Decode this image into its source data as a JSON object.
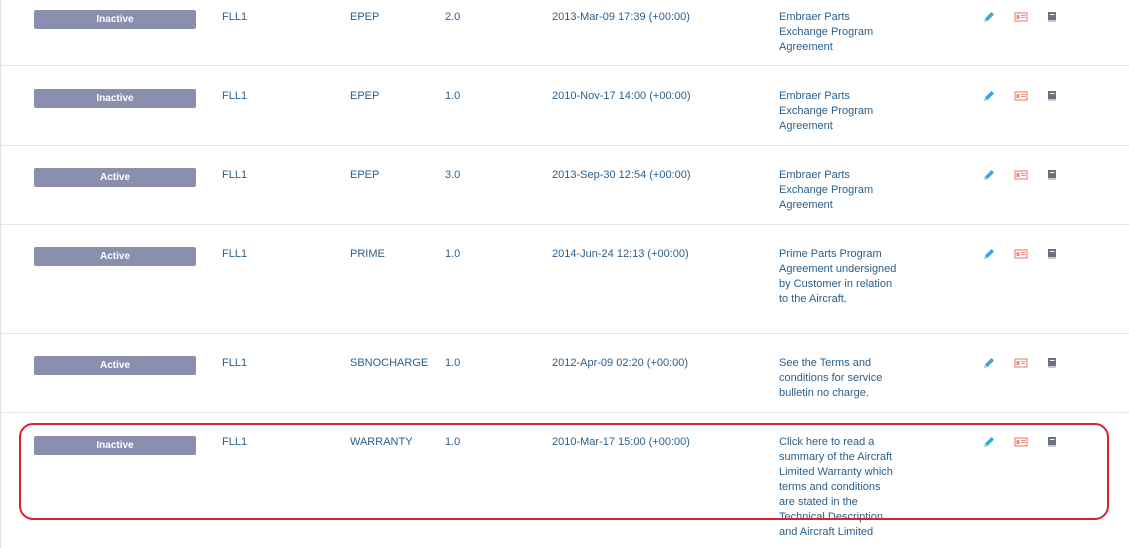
{
  "rows": [
    {
      "status": "Inactive",
      "code": "FLL1",
      "program": "EPEP",
      "version": "2.0",
      "date": "2013-Mar-09 17:39 (+00:00)",
      "description": "Embraer Parts Exchange Program Agreement"
    },
    {
      "status": "Inactive",
      "code": "FLL1",
      "program": "EPEP",
      "version": "1.0",
      "date": "2010-Nov-17 14:00 (+00:00)",
      "description": "Embraer Parts Exchange Program Agreement"
    },
    {
      "status": "Active",
      "code": "FLL1",
      "program": "EPEP",
      "version": "3.0",
      "date": "2013-Sep-30 12:54 (+00:00)",
      "description": "Embraer Parts Exchange Program Agreement"
    },
    {
      "status": "Active",
      "code": "FLL1",
      "program": "PRIME",
      "version": "1.0",
      "date": "2014-Jun-24 12:13 (+00:00)",
      "description": "Prime Parts Program Agreement undersigned by Customer in relation to the Aircraft."
    },
    {
      "status": "Active",
      "code": "FLL1",
      "program": "SBNOCHARGE",
      "version": "1.0",
      "date": "2012-Apr-09 02:20 (+00:00)",
      "description": "See the Terms and conditions for service bulletin no charge."
    },
    {
      "status": "Inactive",
      "code": "FLL1",
      "program": "WARRANTY",
      "version": "1.0",
      "date": "2010-Mar-17 15:00 (+00:00)",
      "description": "Click here to read a summary of the Aircraft Limited Warranty which terms and conditions are stated in the Technical Description and Aircraft Limited"
    }
  ],
  "icons": {
    "edit": "pencil-icon",
    "card": "id-card-icon",
    "book": "book-icon"
  },
  "colors": {
    "badge": "#8a8fae",
    "text": "#2b5f8a",
    "edit": "#3aa6d8",
    "card": "#e98c7c",
    "book": "#6b7380",
    "highlight": "#d9232d"
  }
}
